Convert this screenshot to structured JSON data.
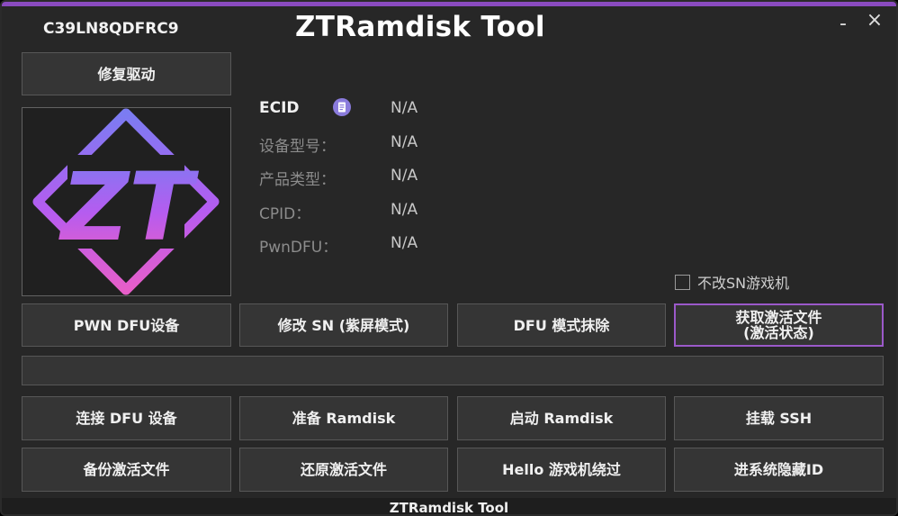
{
  "window": {
    "serial": "C39LN8QDFRC9",
    "title": "ZTRamdisk Tool",
    "minimize_label": "-",
    "close_label": "×",
    "accent_color": "#8a4bbf"
  },
  "repair_button": "修复驱动",
  "logo": {
    "text": "ZT",
    "icon": "zt-logo-icon"
  },
  "device_info": {
    "ecid_label": "ECID",
    "ecid_value": "N/A",
    "copy_icon": "copy-icon",
    "model_label": "设备型号：",
    "model_value": "N/A",
    "product_label": "产品类型：",
    "product_value": "N/A",
    "cpid_label": "CPID：",
    "cpid_value": "N/A",
    "pwndfu_label": "PwnDFU：",
    "pwndfu_value": "N/A"
  },
  "checkbox": {
    "label": "不改SN游戏机",
    "checked": false
  },
  "row1": {
    "pwn_dfu": "PWN DFU设备",
    "modify_sn": "修改 SN (紫屏模式)",
    "dfu_erase": "DFU 模式抹除",
    "get_activation_line1": "获取激活文件",
    "get_activation_line2": "(激活状态)"
  },
  "progress": {
    "value": 0
  },
  "row2": {
    "connect_dfu": "连接 DFU 设备",
    "prepare_ramdisk": "准备 Ramdisk",
    "boot_ramdisk": "启动 Ramdisk",
    "mount_ssh": "挂载 SSH"
  },
  "row3": {
    "backup_activation": "备份激活文件",
    "restore_activation": "还原激活文件",
    "hello_bypass": "Hello 游戏机绕过",
    "hide_id": "进系统隐藏ID"
  },
  "footer": {
    "title": "ZTRamdisk Tool"
  }
}
